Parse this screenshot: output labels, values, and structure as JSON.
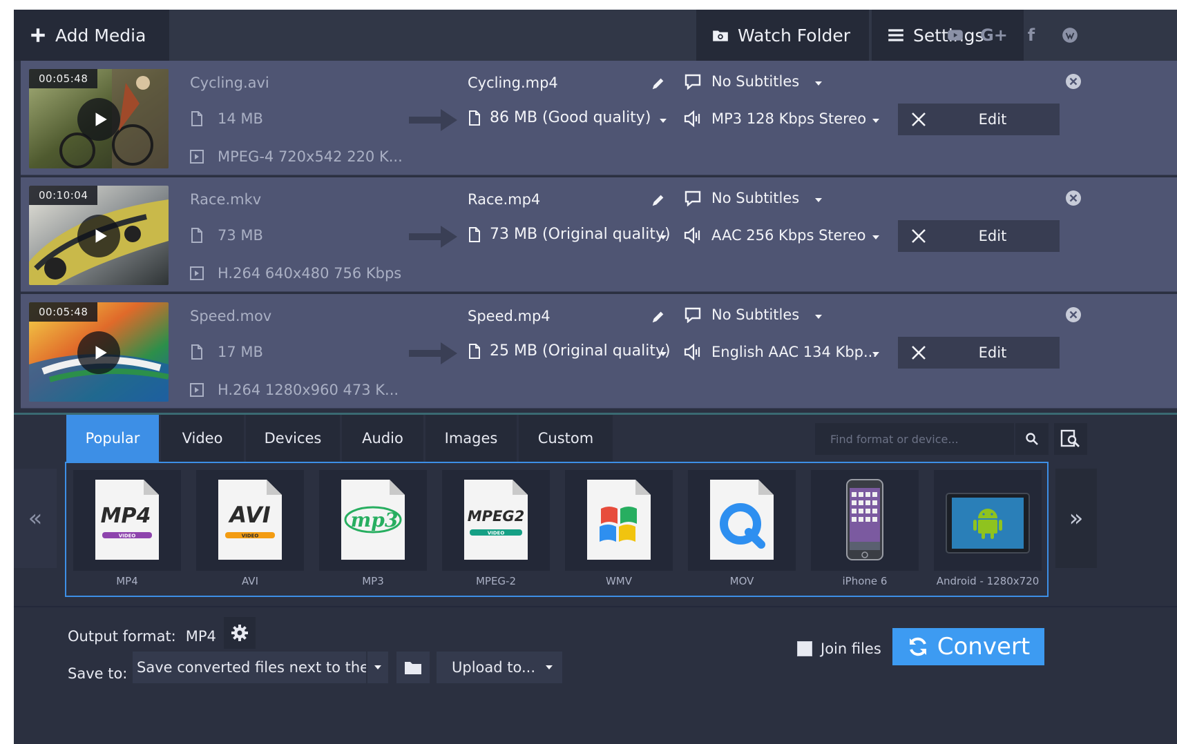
{
  "toolbar": {
    "add_media": "Add Media",
    "watch_folder": "Watch Folder",
    "settings": "Settings",
    "social": [
      "youtube-icon",
      "google-plus-icon",
      "facebook-icon",
      "vk-icon"
    ],
    "google_plus_label": "G+",
    "facebook_label": "f"
  },
  "files": [
    {
      "duration": "00:05:48",
      "source_name": "Cycling.avi",
      "source_size": "14 MB",
      "source_info": "MPEG-4 720x542 220 K...",
      "output_name": "Cycling.mp4",
      "output_size": "86 MB (Good quality)",
      "subtitles": "No Subtitles",
      "audio": "MP3 128 Kbps Stereo",
      "edit": "Edit",
      "thumb_colors": [
        "#5b6b3a",
        "#c8b48a",
        "#2d3a25",
        "#a04a2a"
      ]
    },
    {
      "duration": "00:10:04",
      "source_name": "Race.mkv",
      "source_size": "73 MB",
      "source_info": "H.264 640x480 756 Kbps",
      "output_name": "Race.mp4",
      "output_size": "73 MB (Original quality)",
      "subtitles": "No Subtitles",
      "audio": "AAC 256 Kbps Stereo",
      "edit": "Edit",
      "thumb_colors": [
        "#8a8f92",
        "#c9b94a",
        "#3f4548",
        "#d8d8d0"
      ]
    },
    {
      "duration": "00:05:48",
      "source_name": "Speed.mov",
      "source_size": "17 MB",
      "source_info": "H.264 1280x960 473 K...",
      "output_name": "Speed.mp4",
      "output_size": "25 MB (Original quality)",
      "subtitles": "No Subtitles",
      "audio": "English AAC 134 Kbp...",
      "edit": "Edit",
      "thumb_colors": [
        "#f0c020",
        "#2c8f4a",
        "#e04a2a",
        "#1e5fa0"
      ]
    }
  ],
  "format_panel": {
    "tabs": [
      "Popular",
      "Video",
      "Devices",
      "Audio",
      "Images",
      "Custom"
    ],
    "active_tab": "Popular",
    "search_placeholder": "Find format or device...",
    "nav_prev": "«",
    "nav_next": "»",
    "formats": [
      {
        "label": "MP4",
        "badge": "MP4",
        "badge_sub": "VIDEO",
        "accent": "#8e44ad"
      },
      {
        "label": "AVI",
        "badge": "AVI",
        "badge_sub": "VIDEO",
        "accent": "#f39c12"
      },
      {
        "label": "MP3",
        "badge": "mp3",
        "badge_sub": "",
        "accent": "#27ae60"
      },
      {
        "label": "MPEG-2",
        "badge": "MPEG2",
        "badge_sub": "VIDEO",
        "accent": "#16a085"
      },
      {
        "label": "WMV",
        "badge": "",
        "badge_sub": "",
        "accent": "#e74c3c"
      },
      {
        "label": "MOV",
        "badge": "",
        "badge_sub": "",
        "accent": "#2e8ff0"
      },
      {
        "label": "iPhone 6",
        "badge": "",
        "badge_sub": "",
        "accent": "#888888"
      },
      {
        "label": "Android - 1280x720",
        "badge": "",
        "badge_sub": "",
        "accent": "#8fc31f"
      }
    ]
  },
  "bottom": {
    "output_format_label": "Output format:",
    "output_format_value": "MP4",
    "save_to_label": "Save to:",
    "save_to_value": "Save converted files next to the originals",
    "upload_to": "Upload to...",
    "join_files": "Join files",
    "convert": "Convert"
  },
  "colors": {
    "accent": "#3d8fe6",
    "convert": "#3d9bf2",
    "row_bg": "#4f5573",
    "app_bg": "#2b3040"
  }
}
